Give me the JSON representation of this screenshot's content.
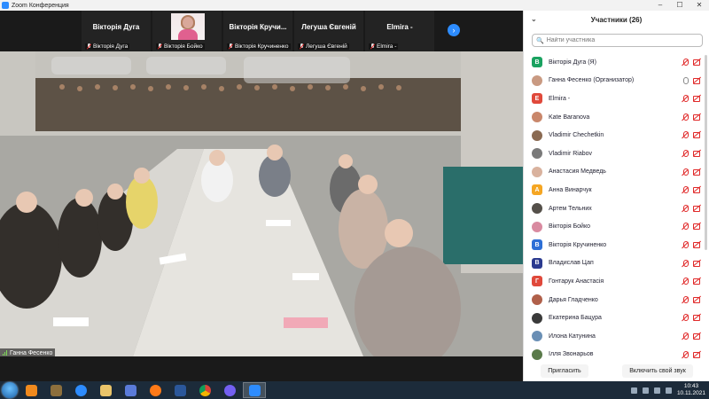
{
  "window": {
    "title": "Zoom Конференция",
    "minimize": "–",
    "maximize": "☐",
    "close": "✕"
  },
  "tiles": [
    {
      "name": "Вікторія Дуга",
      "footer": "Вікторія Дуга"
    },
    {
      "name": "",
      "footer": "Вікторія Бойко"
    },
    {
      "name": "Вікторія  Кручи...",
      "footer": "Вікторія Кручиненко"
    },
    {
      "name": "Легуша Євгеній",
      "footer": "Легуша Євгеній"
    },
    {
      "name": "Elmira -",
      "footer": "Elmira -"
    }
  ],
  "next_arrow": "›",
  "video": {
    "speaker": "Ганна Фесенко"
  },
  "panel": {
    "title": "Участники  (26)",
    "collapse": "⌄",
    "search_placeholder": "Найти участника",
    "participants": [
      {
        "name": "Вікторія Дуга (Я)",
        "initial": "В",
        "color": "#1aa260",
        "mic": "muted"
      },
      {
        "name": "Ганна Фесенко (Организатор)",
        "initial": "",
        "color": "#c99a82",
        "mic": "on"
      },
      {
        "name": "Elmira -",
        "initial": "E",
        "color": "#e0493b",
        "mic": "muted"
      },
      {
        "name": "Kate Baranova",
        "initial": "",
        "color": "#c9876b",
        "mic": "muted"
      },
      {
        "name": "Vladimir Chechetkin",
        "initial": "",
        "color": "#8a6a52",
        "mic": "muted"
      },
      {
        "name": "Vladimir Riabov",
        "initial": "",
        "color": "#7a7a7a",
        "mic": "muted"
      },
      {
        "name": "Анастасия Медведь",
        "initial": "",
        "color": "#d9b29e",
        "mic": "muted"
      },
      {
        "name": "Анна Винарчук",
        "initial": "А",
        "color": "#f5a623",
        "mic": "muted"
      },
      {
        "name": "Артем Тельних",
        "initial": "",
        "color": "#55504a",
        "mic": "muted"
      },
      {
        "name": "Вікторія Бойко",
        "initial": "",
        "color": "#d98aa0",
        "mic": "muted"
      },
      {
        "name": "Вікторія Кручиненко",
        "initial": "В",
        "color": "#2d6fd6",
        "mic": "muted"
      },
      {
        "name": "Владислав Цап",
        "initial": "В",
        "color": "#2b3a8f",
        "mic": "muted"
      },
      {
        "name": "Гонтарук Анастасія",
        "initial": "Г",
        "color": "#e0493b",
        "mic": "muted"
      },
      {
        "name": "Дарья Гладченко",
        "initial": "",
        "color": "#b0604a",
        "mic": "muted"
      },
      {
        "name": "Екатерина Бацура",
        "initial": "",
        "color": "#3a3a3a",
        "mic": "muted"
      },
      {
        "name": "Илона Катунина",
        "initial": "",
        "color": "#6a8fb5",
        "mic": "muted"
      },
      {
        "name": "Ілля Звонарьов",
        "initial": "",
        "color": "#5a7a4a",
        "mic": "muted"
      }
    ],
    "invite_label": "Пригласить",
    "unmute_label": "Включить свой звук"
  },
  "taskbar": {
    "time": "10:43",
    "date": "10.11.2021"
  },
  "colors": {
    "accent": "#2d8cff",
    "muted_red": "#e02828",
    "panel_bg": "#ffffff",
    "stage_bg": "#1a1a1a"
  }
}
